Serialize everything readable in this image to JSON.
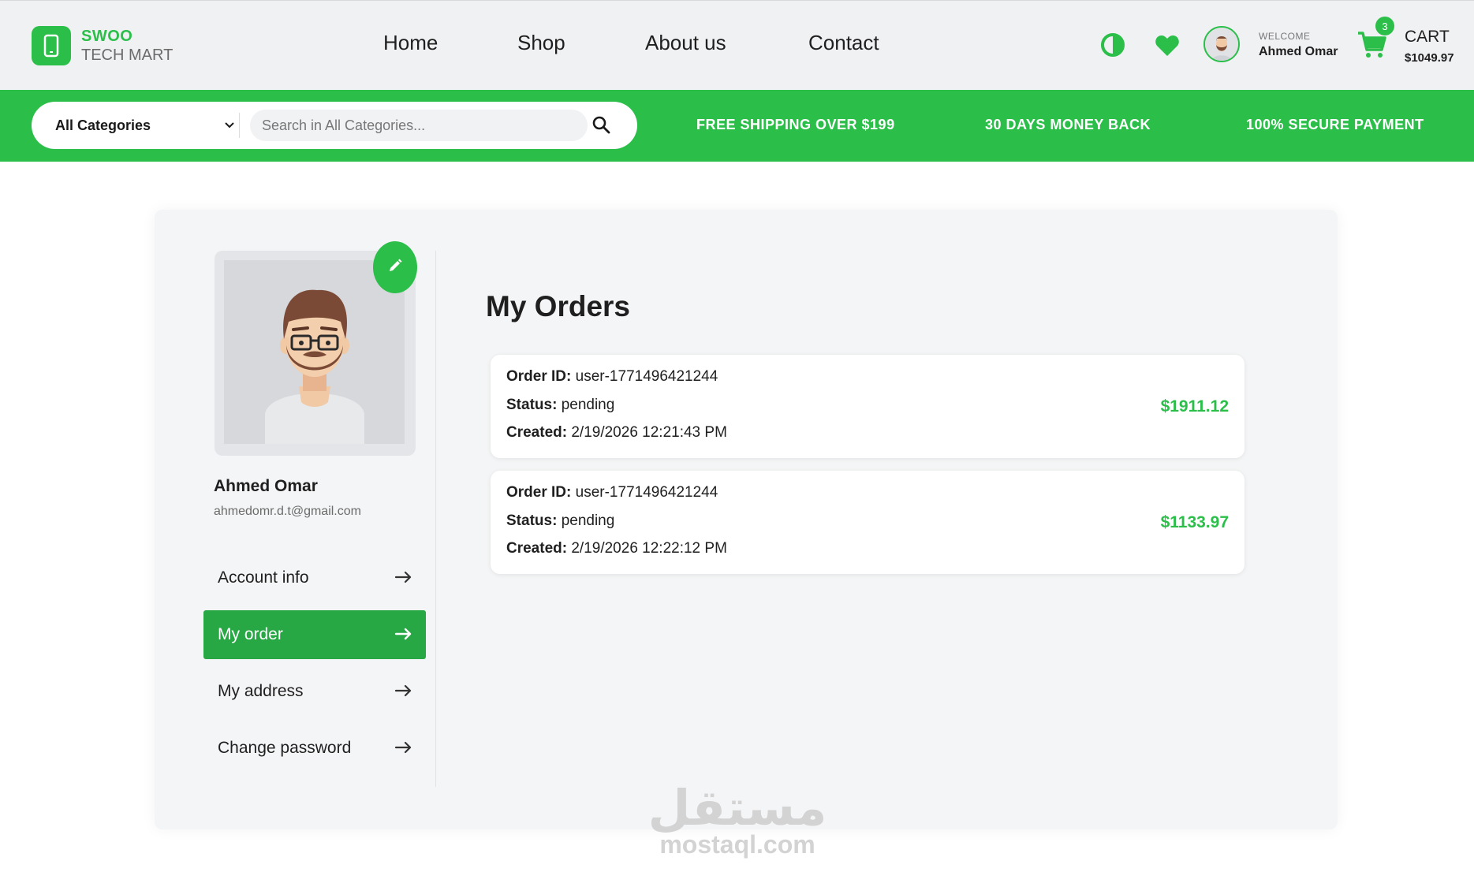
{
  "brand": {
    "line1": "SWOO",
    "line2": "TECH MART",
    "color": "#2bbf4a"
  },
  "nav": {
    "items": [
      "Home",
      "Shop",
      "About us",
      "Contact"
    ]
  },
  "header": {
    "icons": [
      "contrast-icon",
      "heart-icon",
      "avatar",
      "cart-icon"
    ],
    "welcome_label": "WELCOME",
    "user_name": "Ahmed Omar",
    "cart_label": "CART",
    "cart_total": "$1049.97",
    "cart_count": "3"
  },
  "searchbar": {
    "category_value": "All Categories",
    "placeholder": "Search in All Categories..."
  },
  "promos": [
    "FREE SHIPPING OVER $199",
    "30 DAYS MONEY BACK",
    "100% SECURE PAYMENT"
  ],
  "profile": {
    "name": "Ahmed Omar",
    "email": "ahmedomr.d.t@gmail.com"
  },
  "menu": [
    {
      "label": "Account info",
      "active": false
    },
    {
      "label": "My order",
      "active": true
    },
    {
      "label": "My address",
      "active": false
    },
    {
      "label": "Change password",
      "active": false
    }
  ],
  "orders_section": {
    "title": "My Orders",
    "labels": {
      "id": "Order ID:",
      "status": "Status:",
      "created": "Created:"
    },
    "orders": [
      {
        "id": "user-1771496421244",
        "status": "pending",
        "created": "2/19/2026 12:21:43 PM",
        "total": "$1911.12"
      },
      {
        "id": "user-1771496421244",
        "status": "pending",
        "created": "2/19/2026 12:22:12 PM",
        "total": "$1133.97"
      }
    ]
  },
  "watermark": {
    "arabic": "مستقل",
    "latin": "mostaql.com"
  },
  "colors": {
    "accent": "#2bbf4a",
    "active_menu": "#28a745",
    "page_bg": "#f0f1f3"
  }
}
